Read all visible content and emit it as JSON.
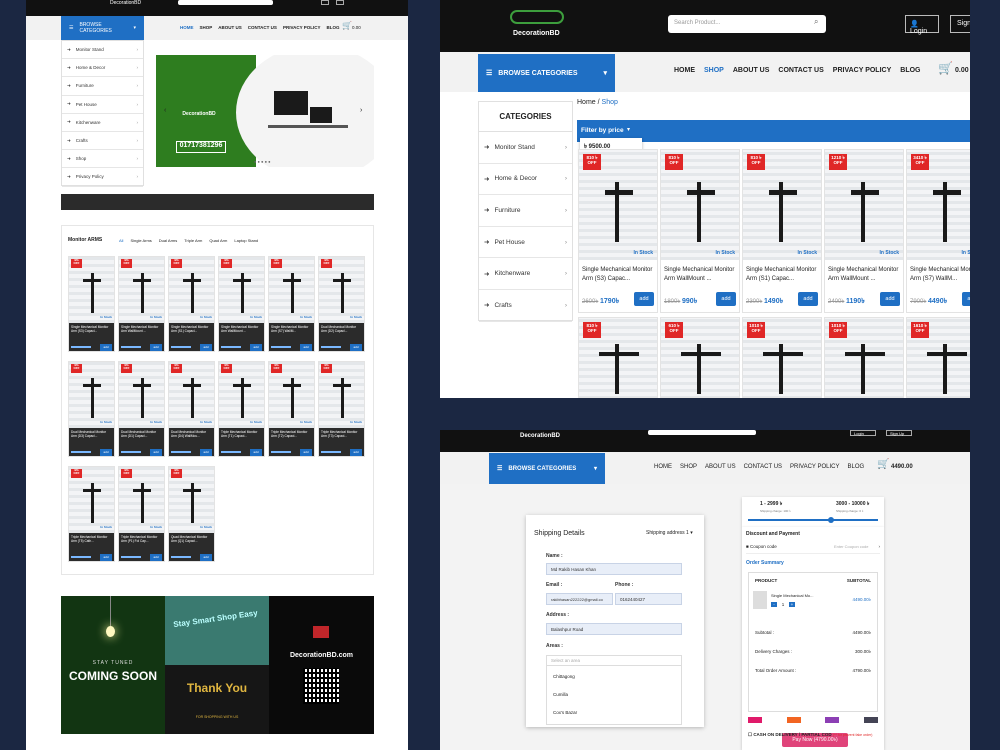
{
  "brand": "DecorationBD",
  "colors": {
    "accent": "#1f6fc4",
    "dark": "#111111",
    "sale": "#e02727"
  },
  "p1": {
    "browse": "BROWSE CATEGORIES",
    "nav": [
      "HOME",
      "SHOP",
      "ABOUT US",
      "CONTACT US",
      "PRIVACY POLICY",
      "BLOG"
    ],
    "cart_total": "0.00",
    "categories": [
      "Monitor Stand",
      "Home & Decor",
      "Furniture",
      "Pet House",
      "Kitchenware",
      "Crafts",
      "Shop",
      "Privacy Policy"
    ],
    "hero_phone": "01717381296",
    "section_title": "Monitor ARMS",
    "section_tabs": [
      "All",
      "Single Arms",
      "Dual Arms",
      "Triple Arm",
      "Quad Arm",
      "Laptop Stand"
    ],
    "products": [
      {
        "badge": "9% OFF",
        "name": "Single Mechanical Monitor Arm (S3) Capaci..."
      },
      {
        "badge": "9% OFF",
        "name": "Single Mechanical Monitor Arm WallMount ..."
      },
      {
        "badge": "9% OFF",
        "name": "Single Mechanical Monitor Arm (S1) Capaci..."
      },
      {
        "badge": "9% OFF",
        "name": "Single Mechanical Monitor Arm WallMount ..."
      },
      {
        "badge": "9% OFF",
        "name": "Single Mechanical Monitor Arm (S7) WallM..."
      },
      {
        "badge": "9% OFF",
        "name": "Dual Mechanical Monitor Arm (D2) Capaci..."
      },
      {
        "badge": "9% OFF",
        "name": "Dual Mechanical Monitor Arm (D3) Capaci..."
      },
      {
        "badge": "9% OFF",
        "name": "Dual Mechanical Monitor Arm (D1) Capaci..."
      },
      {
        "badge": "9% OFF",
        "name": "Dual Mechanical Monitor Arm (D4) WallMou..."
      },
      {
        "badge": "9% OFF",
        "name": "Triple Mechanical Monitor Arm (T1) Capaci..."
      },
      {
        "badge": "9% OFF",
        "name": "Triple Mechanical Monitor Arm (T2) Capaci..."
      },
      {
        "badge": "9% OFF",
        "name": "Triple Mechanical Monitor Arm (T3) Capaci..."
      },
      {
        "badge": "9% OFF",
        "name": "Triple Mechanical Monitor Arm (T5) Cath..."
      },
      {
        "badge": "9% OFF",
        "name": "Triple Mechanical Monitor Arm (P1) Fol Cap..."
      },
      {
        "badge": "9% OFF",
        "name": "Quad Mechanical Monitor Arm (Q1) Capaci..."
      }
    ],
    "stock": "In Stock",
    "add": "add",
    "promo": {
      "stay": "STAY TUNED",
      "coming": "COMING SOON",
      "smart": "Stay Smart Shop Easy",
      "thank": "Thank You",
      "thank_sub": "FOR SHOPPING WITH US",
      "site": "DecorationBD.com"
    }
  },
  "p2": {
    "search_placeholder": "Search Product...",
    "login": "Login",
    "sign": "Sign",
    "browse": "BROWSE CATEGORIES",
    "nav": [
      "HOME",
      "SHOP",
      "ABOUT US",
      "CONTACT US",
      "PRIVACY POLICY",
      "BLOG"
    ],
    "cart_total": "0.00",
    "categories_title": "CATEGORIES",
    "categories": [
      "Monitor Stand",
      "Home & Decor",
      "Furniture",
      "Pet House",
      "Kitchenware",
      "Crafts"
    ],
    "breadcrumb_home": "Home",
    "breadcrumb_sep": " / ",
    "breadcrumb_current": "Shop",
    "filter": "Filter by price",
    "price_value": "৳ 9500.00",
    "stock": "In Stock",
    "add": "add",
    "products": [
      {
        "badge": "810 ৳ OFF",
        "name": "Single Mechanical Monitor Arm (S3) Capac...",
        "old": "2600৳",
        "new": "1790৳"
      },
      {
        "badge": "810 ৳ OFF",
        "name": "Single Mechanical Monitor Arm WallMount ...",
        "old": "1800৳",
        "new": "990৳"
      },
      {
        "badge": "810 ৳ OFF",
        "name": "Single Mechanical Monitor Arm (S1) Capac...",
        "old": "2300৳",
        "new": "1490৳"
      },
      {
        "badge": "1210 ৳ OFF",
        "name": "Single Mechanical Monitor Arm WallMount ...",
        "old": "2400৳",
        "new": "1190৳"
      },
      {
        "badge": "3410 ৳ OFF",
        "name": "Single Mechanical Monitor Arm (S7) WallM...",
        "old": "7900৳",
        "new": "4490৳"
      }
    ],
    "row2_badges": [
      "810 ৳ OFF",
      "610 ৳ OFF",
      "1010 ৳ OFF",
      "1010 ৳ OFF",
      "1610 ৳ OFF"
    ]
  },
  "p3": {
    "login": "Login",
    "signup": "Sign Up",
    "browse": "BROWSE CATEGORIES",
    "nav": [
      "HOME",
      "SHOP",
      "ABOUT US",
      "CONTACT US",
      "PRIVACY POLICY",
      "BLOG"
    ],
    "cart_total": "4490.00",
    "shipping_title": "Shipping Details",
    "shipping_select": "Shipping address 1",
    "name_label": "Name :",
    "name_value": "Md Rakib Hasan Khan",
    "email_label": "Email :",
    "email_value": "rakibhasan222222@gmail.co",
    "phone_label": "Phone :",
    "phone_value": "0162440427",
    "address_label": "Address :",
    "address_value": "Balashpur Road",
    "areas_label": "Areas :",
    "area_placeholder": "Select an area",
    "areas": [
      "Chittagong",
      "Cumilla",
      "Cox's Bazar"
    ],
    "tier1": "1 - 2999 ৳",
    "tier2": "3000 - 10000 ৳",
    "tier1_sub": "Shipping charge: 100 ৳",
    "tier2_sub": "Shipping charge: 0 ৳",
    "discount_title": "Discount and Payment",
    "coupon_label": "Coupon code",
    "coupon_placeholder": "Enter Coupon code",
    "order_summary": "Order Summary",
    "th_product": "PRODUCT",
    "th_subtotal": "SUBTOTAL",
    "item_name": "Single Mechanical Mo...",
    "item_qty": "1",
    "item_price": "4490.00৳",
    "subtotal_label": "Subtotal :",
    "subtotal_value": "4490.00৳",
    "delivery_label": "Delivery Charges :",
    "delivery_value": "300.00৳",
    "total_label": "Total Order Amount :",
    "total_value": "4790.00৳",
    "pay_now": "Pay Now (4790.00৳)",
    "cod": "CASH ON DELIVERY / PARTIAL COD",
    "cod_note": "(** for prevent fake order)"
  }
}
